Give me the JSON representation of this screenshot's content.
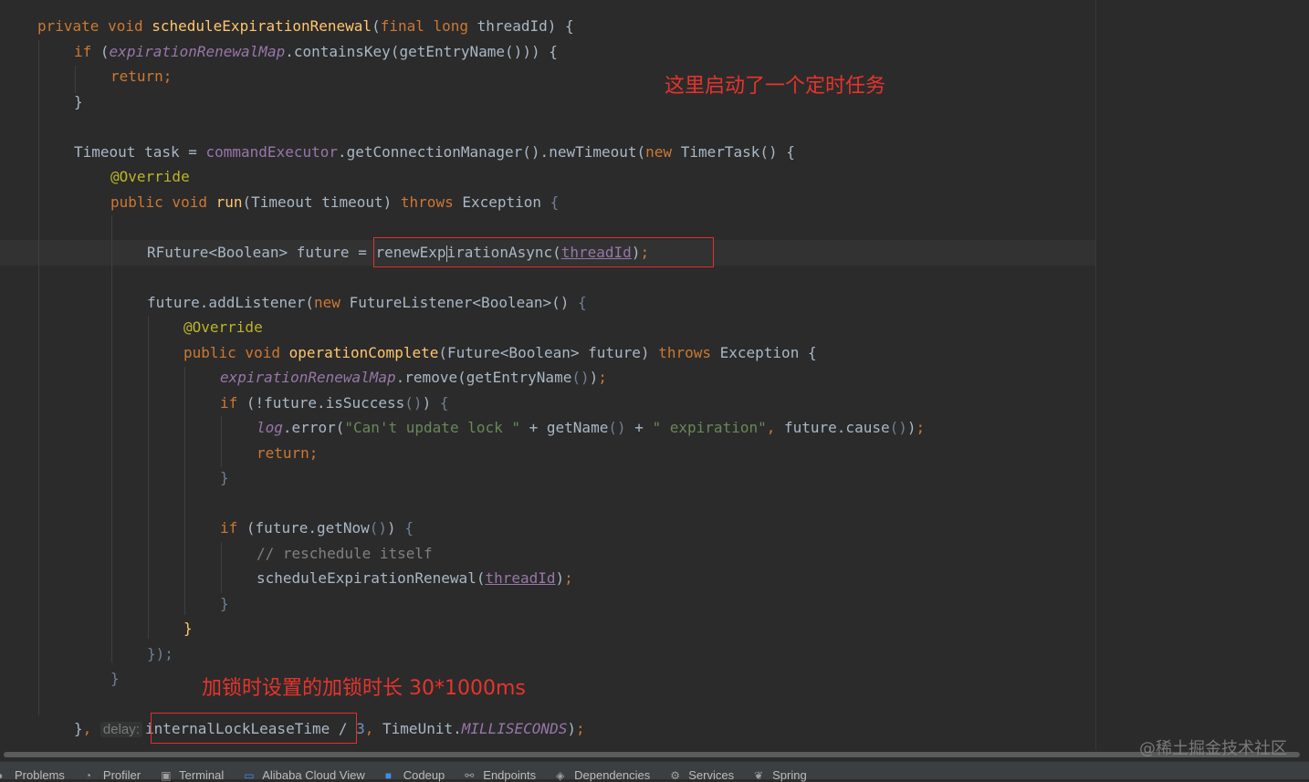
{
  "editor": {
    "lines": [
      {
        "id": "l1",
        "parts": [
          [
            "kw",
            "private void "
          ],
          [
            "fn",
            "scheduleExpirationRenewal"
          ],
          [
            "par",
            "("
          ],
          [
            "kw",
            "final long "
          ],
          [
            "",
            "threadId"
          ],
          [
            "par",
            ") {"
          ]
        ]
      },
      {
        "id": "l2",
        "parts": [
          [
            "kw",
            "if "
          ],
          [
            "par",
            "("
          ],
          [
            "fld",
            "expirationRenewalMap"
          ],
          [
            "",
            "."
          ],
          [
            "",
            "containsKey"
          ],
          [
            "par",
            "("
          ],
          [
            "",
            "getEntryName"
          ],
          [
            "par",
            "())) {"
          ]
        ]
      },
      {
        "id": "l3",
        "parts": [
          [
            "kw",
            "return;"
          ]
        ]
      },
      {
        "id": "l4",
        "parts": [
          [
            "par",
            "}"
          ]
        ]
      },
      {
        "id": "l5",
        "parts": [
          [
            "",
            "Timeout task = "
          ],
          [
            "fld2",
            "commandExecutor"
          ],
          [
            "",
            ".getConnectionManager().newTimeout("
          ],
          [
            "kw",
            "new "
          ],
          [
            "",
            "TimerTask"
          ],
          [
            "par",
            "() {"
          ]
        ]
      },
      {
        "id": "l6",
        "parts": [
          [
            "ann",
            "@Override"
          ]
        ]
      },
      {
        "id": "l7",
        "parts": [
          [
            "kw",
            "public void "
          ],
          [
            "fn",
            "run"
          ],
          [
            "par",
            "("
          ],
          [
            "",
            "Timeout timeout"
          ],
          [
            "par",
            ") "
          ],
          [
            "kw",
            "throws "
          ],
          [
            "",
            "Exception "
          ],
          [
            "dim",
            "{"
          ]
        ]
      },
      {
        "id": "l8",
        "parts": [
          [
            "",
            "RFuture<Boolean> future = "
          ],
          [
            "",
            "renewExp"
          ],
          [
            "caret",
            ""
          ],
          [
            "",
            "irationAsync"
          ],
          [
            "par",
            "("
          ],
          [
            "ul",
            "threadId"
          ],
          [
            "par",
            ")"
          ],
          [
            "kw",
            ";"
          ]
        ]
      },
      {
        "id": "l9",
        "parts": [
          [
            "",
            "future.addListener"
          ],
          [
            "par",
            "("
          ],
          [
            "kw",
            "new "
          ],
          [
            "",
            "FutureListener<Boolean>() "
          ],
          [
            "dim",
            "{"
          ]
        ]
      },
      {
        "id": "l10",
        "parts": [
          [
            "ann",
            "@Override"
          ]
        ]
      },
      {
        "id": "l11",
        "parts": [
          [
            "kw",
            "public void "
          ],
          [
            "fn",
            "operationComplete"
          ],
          [
            "par",
            "("
          ],
          [
            "",
            "Future<Boolean> future"
          ],
          [
            "par",
            ") "
          ],
          [
            "kw",
            "throws "
          ],
          [
            "",
            "Exception {"
          ]
        ]
      },
      {
        "id": "l12",
        "parts": [
          [
            "fld",
            "expirationRenewalMap"
          ],
          [
            "",
            ".remove"
          ],
          [
            "par",
            "("
          ],
          [
            "",
            "getEntryName"
          ],
          [
            "dim",
            "()"
          ],
          [
            "par",
            ")"
          ],
          [
            "kw",
            ";"
          ]
        ]
      },
      {
        "id": "l13",
        "parts": [
          [
            "kw",
            "if "
          ],
          [
            "par",
            "(!"
          ],
          [
            "",
            "future.isSuccess"
          ],
          [
            "dim",
            "()"
          ],
          [
            "par",
            ") "
          ],
          [
            "dim",
            "{"
          ]
        ]
      },
      {
        "id": "l14",
        "parts": [
          [
            "fld",
            "log"
          ],
          [
            "",
            ".error"
          ],
          [
            "par",
            "("
          ],
          [
            "str",
            "\"Can't update lock \""
          ],
          [
            "",
            " + getName"
          ],
          [
            "dim",
            "()"
          ],
          [
            "",
            " + "
          ],
          [
            "str",
            "\" expiration\""
          ],
          [
            "kw",
            ", "
          ],
          [
            "",
            "future.cause"
          ],
          [
            "dim",
            "()"
          ],
          [
            "par",
            ")"
          ],
          [
            "kw",
            ";"
          ]
        ]
      },
      {
        "id": "l15",
        "parts": [
          [
            "kw",
            "return;"
          ]
        ]
      },
      {
        "id": "l16",
        "parts": [
          [
            "dim",
            "}"
          ]
        ]
      },
      {
        "id": "l17",
        "parts": [
          [
            "kw",
            "if "
          ],
          [
            "par",
            "("
          ],
          [
            "",
            "future.getNow"
          ],
          [
            "dim",
            "()"
          ],
          [
            "par",
            ") "
          ],
          [
            "dim",
            "{"
          ]
        ]
      },
      {
        "id": "l18",
        "parts": [
          [
            "cmt",
            "// reschedule itself"
          ]
        ]
      },
      {
        "id": "l19",
        "parts": [
          [
            "",
            "scheduleExpirationRenewal"
          ],
          [
            "par",
            "("
          ],
          [
            "ul",
            "threadId"
          ],
          [
            "par",
            ")"
          ],
          [
            "kw",
            ";"
          ]
        ]
      },
      {
        "id": "l20",
        "parts": [
          [
            "dim",
            "}"
          ]
        ]
      },
      {
        "id": "l21",
        "parts": [
          [
            "fn",
            "}"
          ]
        ]
      },
      {
        "id": "l22",
        "parts": [
          [
            "dim",
            "});"
          ]
        ]
      },
      {
        "id": "l23",
        "parts": [
          [
            "dim",
            "}"
          ]
        ]
      },
      {
        "id": "l24",
        "parts": [
          [
            "par",
            "}"
          ],
          [
            "kw",
            ", "
          ],
          [
            "hint",
            "delay:"
          ],
          [
            "",
            ""
          ],
          [
            "",
            "internalLockLeaseTime "
          ],
          [
            "par",
            "/ "
          ],
          [
            "num",
            "3"
          ],
          [
            "kw",
            ", "
          ],
          [
            "",
            "TimeUnit."
          ],
          [
            "fld",
            "MILLISECONDS"
          ],
          [
            "par",
            ")"
          ],
          [
            "kw",
            ";"
          ]
        ]
      }
    ]
  },
  "annotations": {
    "note1": "这里启动了一个定时任务",
    "note2": "加锁时设置的加锁时长 30*1000ms"
  },
  "toolbar": {
    "items": [
      {
        "label": "Problems",
        "icon": "problems-icon"
      },
      {
        "label": "Profiler",
        "icon": "profiler-icon"
      },
      {
        "label": "Terminal",
        "icon": "terminal-icon"
      },
      {
        "label": "Alibaba Cloud View",
        "icon": "alibaba-cloud-icon"
      },
      {
        "label": "Codeup",
        "icon": "codeup-icon"
      },
      {
        "label": "Endpoints",
        "icon": "endpoints-icon"
      },
      {
        "label": "Dependencies",
        "icon": "dependencies-icon"
      },
      {
        "label": "Services",
        "icon": "services-icon"
      },
      {
        "label": "Spring",
        "icon": "spring-icon"
      }
    ]
  },
  "watermark": "@稀土掘金技术社区",
  "colors": {
    "accent_red": "#e0302f",
    "keyword": "#cc7832",
    "function": "#ffc66d",
    "field": "#9876aa",
    "string": "#6a8759",
    "number": "#6897bb",
    "annotation": "#bbb529"
  }
}
